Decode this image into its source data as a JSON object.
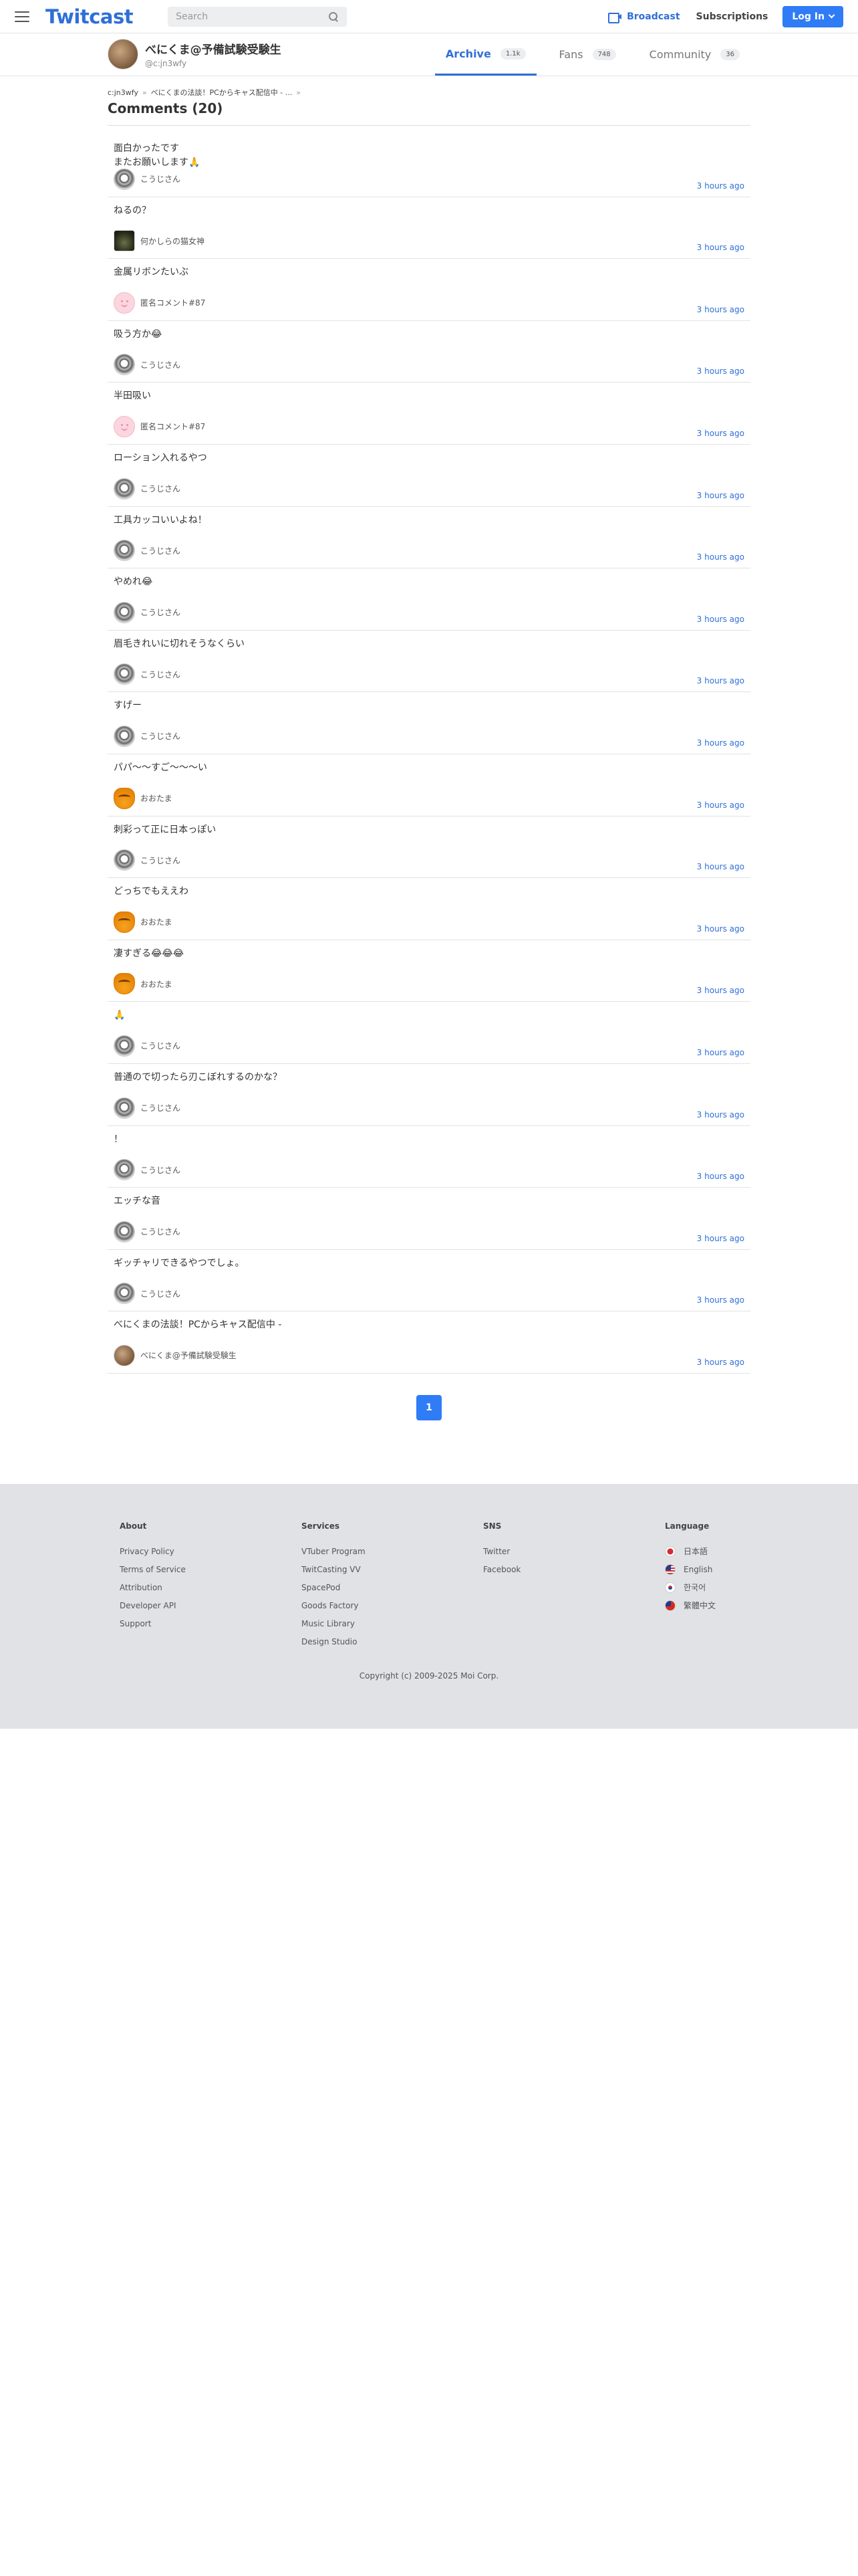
{
  "header": {
    "logo": "Twitcast",
    "search_placeholder": "Search",
    "broadcast_label": "Broadcast",
    "subscriptions_label": "Subscriptions",
    "login_label": "Log In"
  },
  "profile": {
    "name": "べにくま@予備試験受験生",
    "id": "@c:jn3wfy"
  },
  "tabs": [
    {
      "label": "Archive",
      "count": "1.1k",
      "active": true
    },
    {
      "label": "Fans",
      "count": "748",
      "active": false
    },
    {
      "label": "Community",
      "count": "36",
      "active": false
    }
  ],
  "breadcrumb": {
    "user": "c:jn3wfy",
    "movie": "べにくまの法談！PCからキャス配信中 - ..."
  },
  "page_title": "Comments (20)",
  "comments": [
    {
      "text": "面白かったです\nまたお願いします🙏",
      "user": "こうじさん",
      "avatar": "kouji",
      "time": "3 hours ago"
    },
    {
      "text": "ねるの？",
      "user": "何かしらの猫女神",
      "avatar": "plant",
      "time": "3 hours ago"
    },
    {
      "text": "金属リボンたいぶ",
      "user": "匿名コメント#87",
      "avatar": "anon",
      "time": "3 hours ago"
    },
    {
      "text": "吸う方か😂",
      "user": "こうじさん",
      "avatar": "kouji",
      "time": "3 hours ago"
    },
    {
      "text": "半田吸い",
      "user": "匿名コメント#87",
      "avatar": "anon",
      "time": "3 hours ago"
    },
    {
      "text": "ローション入れるやつ",
      "user": "こうじさん",
      "avatar": "kouji",
      "time": "3 hours ago"
    },
    {
      "text": "工具カッコいいよね！",
      "user": "こうじさん",
      "avatar": "kouji",
      "time": "3 hours ago"
    },
    {
      "text": "やめれ😂",
      "user": "こうじさん",
      "avatar": "kouji",
      "time": "3 hours ago"
    },
    {
      "text": "眉毛きれいに切れそうなくらい",
      "user": "こうじさん",
      "avatar": "kouji",
      "time": "3 hours ago"
    },
    {
      "text": "すげー",
      "user": "こうじさん",
      "avatar": "kouji",
      "time": "3 hours ago"
    },
    {
      "text": "パパ〜〜すご〜〜〜い",
      "user": "おおたま",
      "avatar": "otama",
      "time": "3 hours ago"
    },
    {
      "text": "刺彩って正に日本っぽい",
      "user": "こうじさん",
      "avatar": "kouji",
      "time": "3 hours ago"
    },
    {
      "text": "どっちでもええわ",
      "user": "おおたま",
      "avatar": "otama",
      "time": "3 hours ago"
    },
    {
      "text": "凄すぎる😂😂😂",
      "user": "おおたま",
      "avatar": "otama",
      "time": "3 hours ago"
    },
    {
      "text": "🙏",
      "user": "こうじさん",
      "avatar": "kouji",
      "time": "3 hours ago"
    },
    {
      "text": "普通ので切ったら刃こぼれするのかな？",
      "user": "こうじさん",
      "avatar": "kouji",
      "time": "3 hours ago"
    },
    {
      "text": "！",
      "user": "こうじさん",
      "avatar": "kouji",
      "time": "3 hours ago"
    },
    {
      "text": "エッチな音",
      "user": "こうじさん",
      "avatar": "kouji",
      "time": "3 hours ago"
    },
    {
      "text": "ギッチャリできるやつでしょ。",
      "user": "こうじさん",
      "avatar": "kouji",
      "time": "3 hours ago"
    },
    {
      "text": "べにくまの法談！PCからキャス配信中 -",
      "user": "べにくま@予備試験受験生",
      "avatar": "owner",
      "time": "3 hours ago"
    }
  ],
  "pagination": {
    "current": "1"
  },
  "footer": {
    "about": {
      "title": "About",
      "links": [
        "Privacy Policy",
        "Terms of Service",
        "Attribution",
        "Developer API",
        "Support"
      ]
    },
    "services": {
      "title": "Services",
      "links": [
        "VTuber Program",
        "TwitCasting VV",
        "SpacePod",
        "Goods Factory",
        "Music Library",
        "Design Studio"
      ]
    },
    "sns": {
      "title": "SNS",
      "links": [
        "Twitter",
        "Facebook"
      ]
    },
    "language": {
      "title": "Language",
      "links": [
        "日本語",
        "English",
        "한국어",
        "繁體中文"
      ]
    },
    "copyright": "Copyright (c) 2009-2025 Moi Corp."
  }
}
